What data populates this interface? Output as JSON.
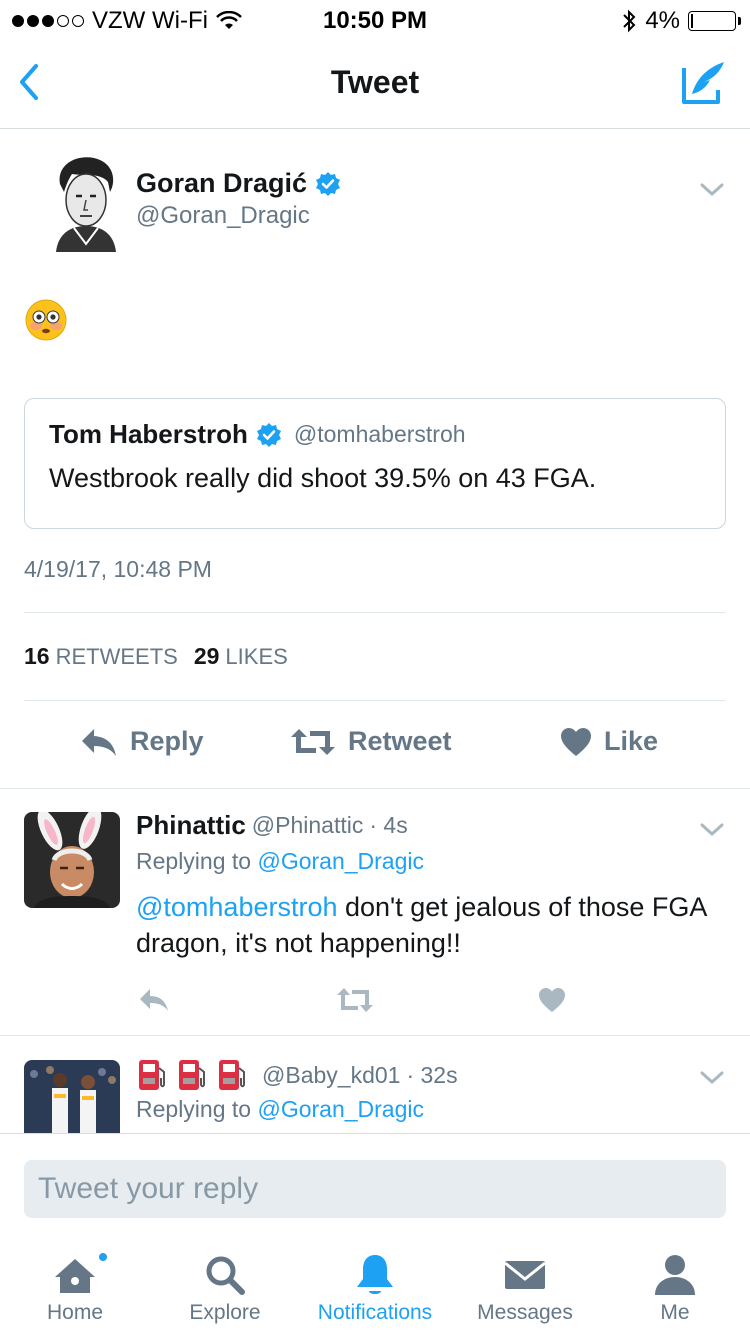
{
  "status_bar": {
    "carrier": "VZW Wi-Fi",
    "time": "10:50 PM",
    "battery": "4%",
    "battery_level": 0.04
  },
  "nav": {
    "title": "Tweet",
    "back_icon": "chevron-left-icon",
    "compose_icon": "compose-icon"
  },
  "tweet": {
    "author_name": "Goran Dragić",
    "author_handle": "@Goran_Dragic",
    "verified": true,
    "text_emoji": "flushed-face-emoji",
    "quote": {
      "author_name": "Tom Haberstroh",
      "author_handle": "@tomhaberstroh",
      "verified": true,
      "text": "Westbrook really did shoot 39.5% on 43 FGA."
    },
    "timestamp": "4/19/17, 10:48 PM",
    "retweets_count": "16",
    "retweets_label": "RETWEETS",
    "likes_count": "29",
    "likes_label": "LIKES",
    "actions": {
      "reply": "Reply",
      "retweet": "Retweet",
      "like": "Like"
    }
  },
  "replies": [
    {
      "name": "Phinattic",
      "handle": "@Phinattic",
      "time": "· 4s",
      "replying_prefix": "Replying to",
      "replying_to": "@Goran_Dragic",
      "mention": "@tomhaberstroh",
      "text": " don't get jealous of those FGA dragon, it's not happening!!"
    },
    {
      "name_emoji": "fuel-pump-emoji",
      "handle": "@Baby_kd01",
      "time": "· 32s",
      "replying_prefix": "Replying to",
      "replying_to": "@Goran_Dragic"
    }
  ],
  "compose": {
    "placeholder": "Tweet your reply"
  },
  "tabs": [
    {
      "label": "Home",
      "icon": "home-icon",
      "active": false,
      "badge": true
    },
    {
      "label": "Explore",
      "icon": "search-icon",
      "active": false
    },
    {
      "label": "Notifications",
      "icon": "bell-icon",
      "active": true
    },
    {
      "label": "Messages",
      "icon": "envelope-icon",
      "active": false
    },
    {
      "label": "Me",
      "icon": "person-icon",
      "active": false
    }
  ],
  "colors": {
    "accent": "#1da1f2",
    "secondary_text": "#657786",
    "primary_text": "#14171a"
  }
}
